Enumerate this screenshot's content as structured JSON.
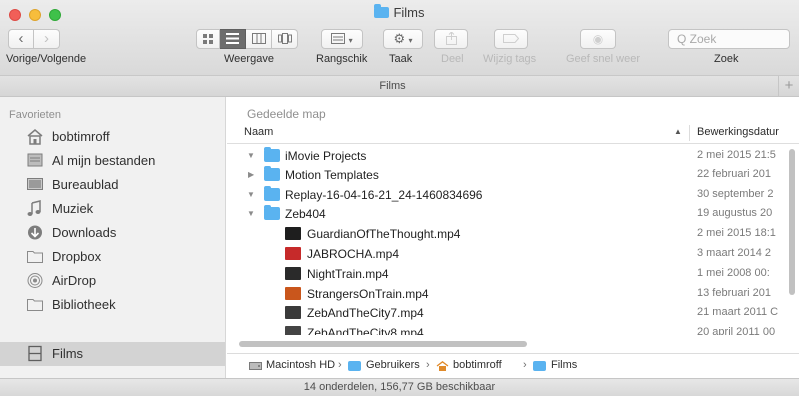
{
  "window": {
    "title": "Films"
  },
  "toolbar": {
    "nav_label": "Vorige/Volgende",
    "view_label": "Weergave",
    "arrange_label": "Rangschik",
    "action_label": "Taak",
    "share_label": "Deel",
    "tags_label": "Wijzig tags",
    "quicklook_label": "Geef snel weer",
    "search_label": "Zoek",
    "search_placeholder": "Q Zoek",
    "back_glyph": "‹",
    "forward_glyph": "›"
  },
  "tabbar": {
    "title": "Films",
    "add_glyph": "+"
  },
  "sidebar": {
    "header": "Favorieten",
    "items": [
      {
        "label": "bobtimroff",
        "icon": "home-icon"
      },
      {
        "label": "Al mijn bestanden",
        "icon": "all-files-icon"
      },
      {
        "label": "Bureaublad",
        "icon": "desktop-icon"
      },
      {
        "label": "Muziek",
        "icon": "music-icon"
      },
      {
        "label": "Downloads",
        "icon": "downloads-icon"
      },
      {
        "label": "Dropbox",
        "icon": "folder-icon"
      },
      {
        "label": "AirDrop",
        "icon": "airdrop-icon"
      },
      {
        "label": "Bibliotheek",
        "icon": "folder-icon"
      },
      {
        "label": "Films",
        "icon": "films-icon",
        "selected": true
      }
    ]
  },
  "main": {
    "section_label": "Gedeelde map",
    "columns": {
      "name": "Naam",
      "date": "Bewerkingsdatur"
    },
    "rows": [
      {
        "name": "iMovie Projects",
        "date": "2 mei 2015 21:5",
        "kind": "folder",
        "expanded": true,
        "level": 0
      },
      {
        "name": "Motion Templates",
        "date": "22 februari 201",
        "kind": "folder",
        "expanded": false,
        "level": 0
      },
      {
        "name": "Replay-16-04-16-21_24-1460834696",
        "date": "30 september 2",
        "kind": "folder",
        "expanded": true,
        "level": 0
      },
      {
        "name": "Zeb404",
        "date": "19 augustus 20",
        "kind": "folder",
        "expanded": true,
        "level": 0
      },
      {
        "name": "GuardianOfTheThought.mp4",
        "date": "2 mei 2015 18:1",
        "kind": "movie",
        "level": 1,
        "thumb": "#1e1e1e"
      },
      {
        "name": "JABROCHA.mp4",
        "date": "3 maart 2014 2",
        "kind": "movie",
        "level": 1,
        "thumb": "#c62a2a"
      },
      {
        "name": "NightTrain.mp4",
        "date": "1 mei 2008 00:",
        "kind": "movie",
        "level": 1,
        "thumb": "#2a2a2a"
      },
      {
        "name": "StrangersOnTrain.mp4",
        "date": "13 februari 201",
        "kind": "movie",
        "level": 1,
        "thumb": "#c9561c"
      },
      {
        "name": "ZebAndTheCity7.mp4",
        "date": "21 maart 2011 C",
        "kind": "movie",
        "level": 1,
        "thumb": "#3a3a3a"
      },
      {
        "name": "ZebAndTheCity8.mp4",
        "date": "20 april 2011 00",
        "kind": "movie",
        "level": 1,
        "thumb": "#444444"
      }
    ]
  },
  "pathbar": {
    "items": [
      {
        "label": "Macintosh HD",
        "icon": "hard-drive-icon"
      },
      {
        "label": "Gebruikers",
        "icon": "folder-icon"
      },
      {
        "label": "bobtimroff",
        "icon": "home-icon"
      },
      {
        "label": "Films",
        "icon": "folder-icon"
      }
    ],
    "separator": "›"
  },
  "status": {
    "text": "14 onderdelen, 156,77 GB beschikbaar"
  },
  "colors": {
    "folder": "#5ab3f0",
    "selection": "#d3d3d3",
    "sidebar": "#f1f1f1"
  }
}
